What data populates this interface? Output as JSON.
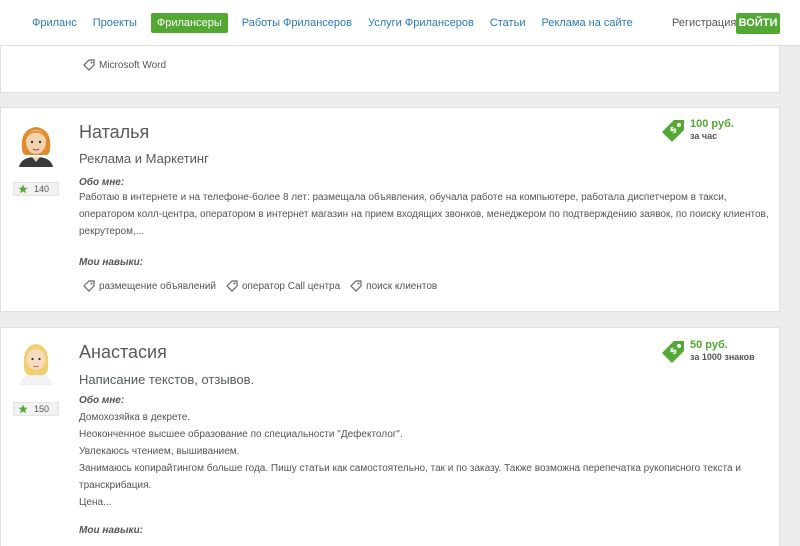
{
  "nav": {
    "items": [
      {
        "label": "Фриланс",
        "active": false
      },
      {
        "label": "Проекты",
        "active": false
      },
      {
        "label": "Фрилансеры",
        "active": true
      },
      {
        "label": "Работы Фрилансеров",
        "active": false
      },
      {
        "label": "Услуги Фрилансеров",
        "active": false
      },
      {
        "label": "Статьи",
        "active": false
      },
      {
        "label": "Реклама на сайте",
        "active": false
      }
    ],
    "register": "Регистрация",
    "login": "ВОЙТИ"
  },
  "prev_card": {
    "skill": "Microsoft Word"
  },
  "freelancers": [
    {
      "name": "Наталья",
      "specialization": "Реклама и Маркетинг",
      "rating": "140",
      "price": "100 руб.",
      "price_unit": "за час",
      "about_label": "Обо мне",
      "about_lines": [
        "Работаю в интернете и на телефоне-более 8 лет: размещала объявления, обучала работе на компьютере, работала диспетчером в такси,",
        "оператором колл-центра, оператором в интернет магазин на прием входящих звонков, менеджером по подтверждению заявок, по поиску клиентов,",
        "рекрутером,..."
      ],
      "skills_label": "Мои навыки",
      "skills": [
        "размещение объявлений",
        "оператор Call центра",
        "поиск клиентов"
      ]
    },
    {
      "name": "Анастасия",
      "specialization": "Написание текстов, отзывов.",
      "rating": "150",
      "price": "50 руб.",
      "price_unit": "за 1000 знаков",
      "about_label": "Обо мне",
      "about_lines": [
        "Домохозяйка в декрете.",
        "Неоконченное высшее образование по специальности \"Дефектолог\".",
        "Увлекаюсь чтением, вышиванием.",
        "Занимаюсь копирайтингом больше года. Пишу статьи как самостоятельно, так и по заказу. Также возможна перепечатка рукописного текста и",
        "транскрибация.",
        "Цена..."
      ],
      "skills_label": "Мои навыки",
      "skills": []
    }
  ],
  "colors": {
    "accent_green": "#52a832",
    "link_blue": "#2a79b8",
    "background": "#ececec"
  },
  "icons": [
    "tag-icon",
    "star-icon",
    "price-tag-icon",
    "avatar-icon"
  ]
}
